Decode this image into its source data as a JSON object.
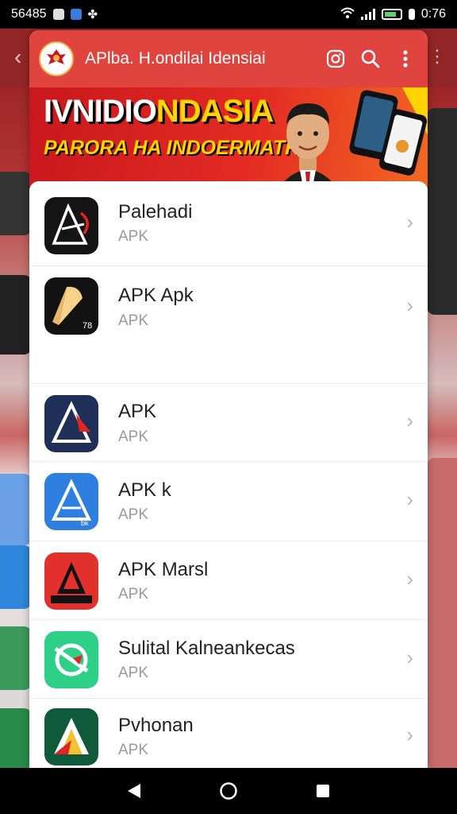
{
  "status_bar": {
    "time_left": "56485",
    "battery_text": "0:76"
  },
  "app_bar": {
    "title": "APlba. H.ondilai Idensiai",
    "icons": [
      "emblem-icon",
      "instagram-icon",
      "search-icon",
      "more-vert-icon"
    ]
  },
  "banner": {
    "headline_part1": "IVNIDIO",
    "headline_part2": "NDASIA",
    "subline": "PARORA HA INDOERMATRN!"
  },
  "apps": [
    {
      "name": "Palehadi",
      "type": "APK",
      "icon": "palehadi-app-icon",
      "colors": [
        "#141414",
        "#ffffff",
        "#e02424"
      ]
    },
    {
      "name": "APK Apk",
      "type": "APK",
      "icon": "apk-apk-app-icon",
      "colors": [
        "#121212",
        "#f4d28a"
      ]
    },
    {
      "name": "APK",
      "type": "APK",
      "icon": "apk-app-icon",
      "colors": [
        "#1f2f57",
        "#e02424"
      ]
    },
    {
      "name": "APK  k",
      "type": "APK",
      "icon": "apk-k-app-icon",
      "colors": [
        "#2f7fe0",
        "#ffffff"
      ]
    },
    {
      "name": "APK Marsl",
      "type": "APK",
      "icon": "apk-marsl-app-icon",
      "colors": [
        "#e2302d",
        "#121212"
      ]
    },
    {
      "name": "Sulital Kalneankecas",
      "type": "APK",
      "icon": "sulital-app-icon",
      "colors": [
        "#2ecf86",
        "#e02424"
      ]
    },
    {
      "name": "Pvhonan",
      "type": "APK",
      "icon": "pvhonan-app-icon",
      "colors": [
        "#0f5a3a",
        "#f2c230",
        "#e02424"
      ]
    }
  ],
  "theme": {
    "accent": "#e0443f",
    "status_bar": "#000000",
    "nav_bar": "#000000"
  }
}
